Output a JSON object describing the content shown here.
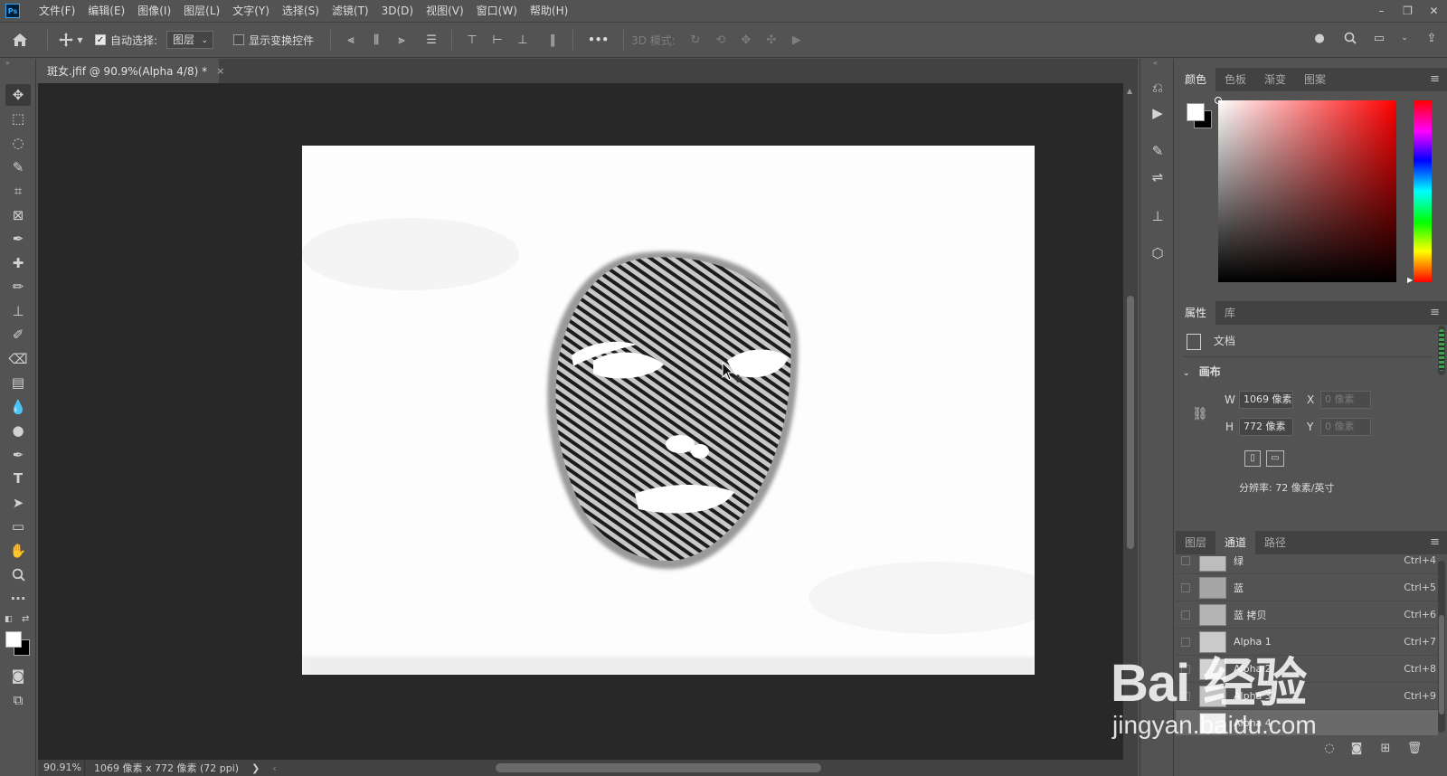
{
  "app": {
    "logo": "Ps"
  },
  "menu": [
    "文件(F)",
    "编辑(E)",
    "图像(I)",
    "图层(L)",
    "文字(Y)",
    "选择(S)",
    "滤镜(T)",
    "3D(D)",
    "视图(V)",
    "窗口(W)",
    "帮助(H)"
  ],
  "window_controls": {
    "minimize": "–",
    "restore": "❐",
    "close": "✕"
  },
  "options": {
    "auto_select_label": "自动选择:",
    "auto_select_checked": true,
    "auto_select_target": "图层",
    "show_transform_label": "显示变换控件",
    "show_transform_checked": false,
    "more": "•••",
    "mode_3d_label": "3D 模式:"
  },
  "document_tab": {
    "title": "斑女.jfif @ 90.9%(Alpha 4/8) *",
    "close": "×"
  },
  "status": {
    "zoom": "90.91%",
    "info": "1069 像素 x 772 像素 (72 ppi)",
    "arrow": "❯",
    "left_arrow": "‹"
  },
  "panels": {
    "color": {
      "tabs": [
        "颜色",
        "色板",
        "渐变",
        "图案"
      ],
      "active": 0,
      "fg": "#ffffff",
      "bg": "#000000"
    },
    "properties": {
      "tabs": [
        "属性",
        "库"
      ],
      "active": 0,
      "type": "文档",
      "section": "画布",
      "w_label": "W",
      "w_value": "1069 像素",
      "h_label": "H",
      "h_value": "772 像素",
      "x_label": "X",
      "x_placeholder": "0 像素",
      "y_label": "Y",
      "y_placeholder": "0 像素",
      "resolution": "分辨率: 72 像素/英寸"
    },
    "channels": {
      "tabs": [
        "图层",
        "通道",
        "路径"
      ],
      "active": 1,
      "rows": [
        {
          "name": "绿",
          "shortcut": "Ctrl+4",
          "selected": false
        },
        {
          "name": "蓝",
          "shortcut": "Ctrl+5",
          "selected": false
        },
        {
          "name": "蓝 拷贝",
          "shortcut": "Ctrl+6",
          "selected": false
        },
        {
          "name": "Alpha 1",
          "shortcut": "Ctrl+7",
          "selected": false
        },
        {
          "name": "Alpha 2",
          "shortcut": "Ctrl+8",
          "selected": false
        },
        {
          "name": "Alpha 3",
          "shortcut": "Ctrl+9",
          "selected": false
        },
        {
          "name": "Alpha 4",
          "shortcut": "",
          "selected": true
        }
      ]
    }
  },
  "watermark": {
    "main": "Bai 经验",
    "sub": "jingyan.baidu.com"
  },
  "colors": {
    "ui_dark": "#535353",
    "canvas_bg": "#282828",
    "accent": "#31a8ff"
  }
}
